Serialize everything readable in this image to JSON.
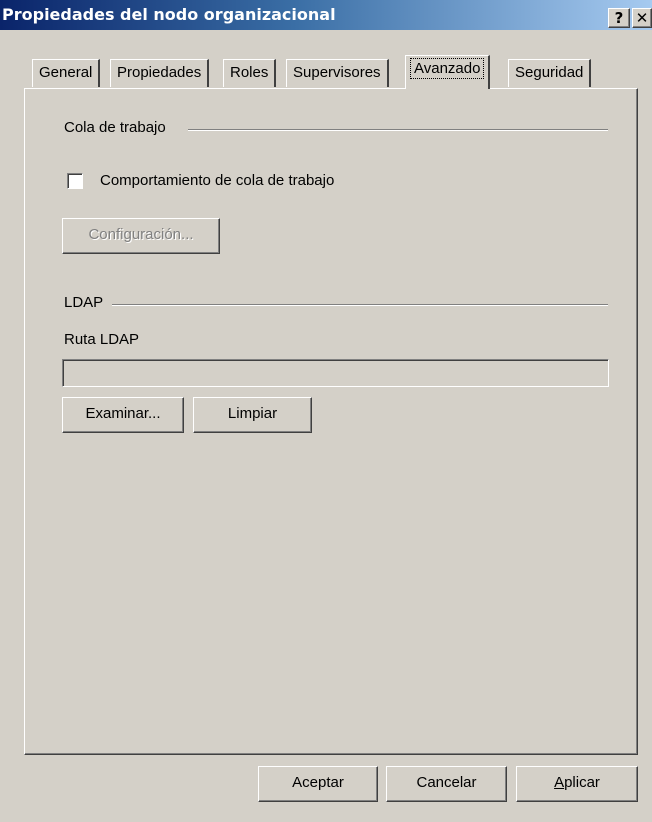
{
  "window": {
    "title": "Propiedades del nodo organizacional",
    "help_glyph": "?",
    "close_glyph": "✕"
  },
  "tabs": [
    {
      "label": "General"
    },
    {
      "label": "Propiedades"
    },
    {
      "label": "Roles"
    },
    {
      "label": "Supervisores"
    },
    {
      "label": "Avanzado",
      "active": true
    },
    {
      "label": "Seguridad"
    }
  ],
  "workqueue": {
    "group_title": "Cola de trabajo",
    "checkbox_label": "Comportamiento de cola de trabajo",
    "checked": false,
    "config_button": "Configuración..."
  },
  "ldap": {
    "group_title": "LDAP",
    "path_label": "Ruta LDAP",
    "path_value": "",
    "browse_button": "Examinar...",
    "clear_button": "Limpiar"
  },
  "footer": {
    "ok_button": "Aceptar",
    "cancel_button": "Cancelar",
    "apply_button_prefix": "",
    "apply_button_mnemonic": "A",
    "apply_button_rest": "plicar"
  }
}
